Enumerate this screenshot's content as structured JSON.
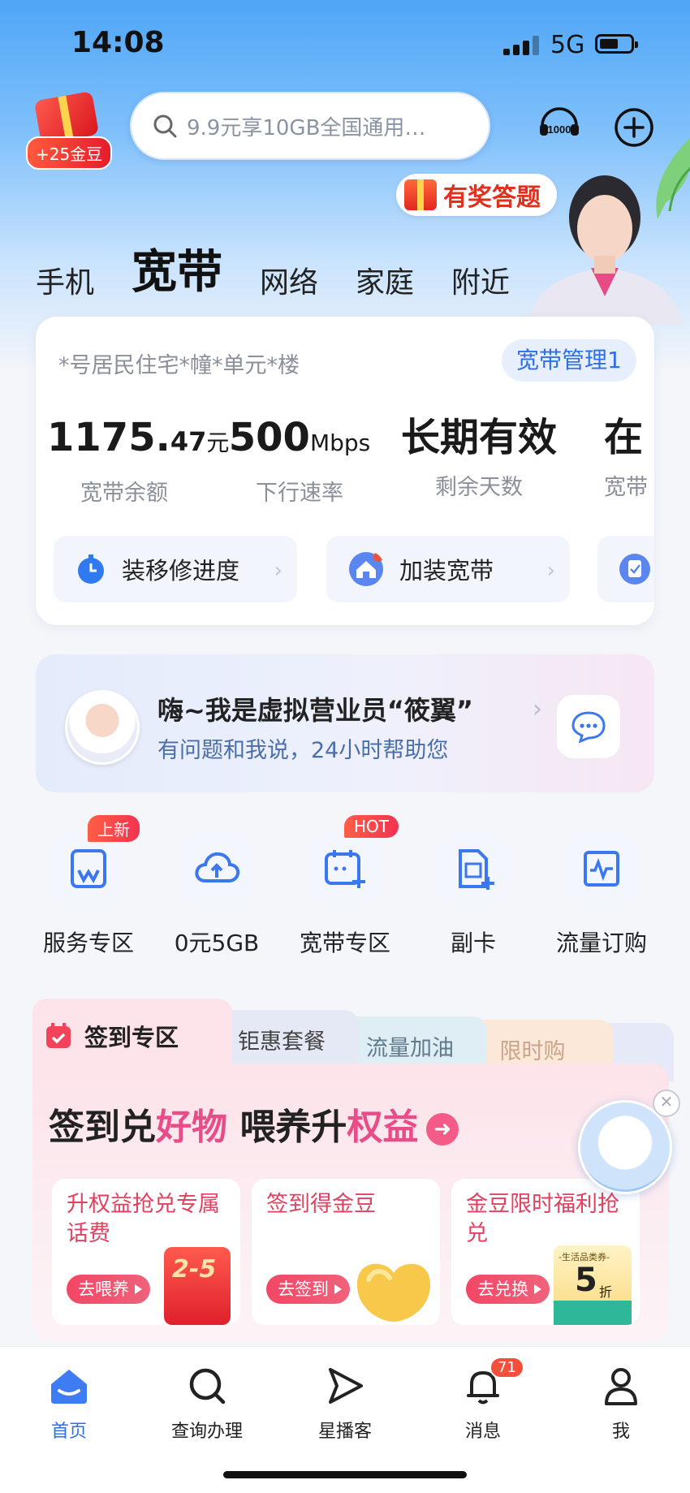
{
  "status_bar": {
    "time": "14:08",
    "network": "5G"
  },
  "header": {
    "coin_badge": "+25金豆",
    "search_placeholder": "9.9元享10GB全国通用…",
    "quiz_tag": "有奖答题"
  },
  "tabs": [
    {
      "label": "手机",
      "active": false
    },
    {
      "label": "宽带",
      "active": true
    },
    {
      "label": "网络",
      "active": false
    },
    {
      "label": "家庭",
      "active": false
    },
    {
      "label": "附近",
      "active": false
    }
  ],
  "broadband": {
    "address": "*号居民住宅*幢*单元*楼",
    "manage_label": "宽带管理1",
    "stats": [
      {
        "int": "1175.",
        "dec": "47",
        "unit": "元",
        "label": "宽带余额"
      },
      {
        "int": "500",
        "dec": "",
        "unit": "Mbps",
        "label": "下行速率"
      },
      {
        "int": "长期有效",
        "dec": "",
        "unit": "",
        "label": "剩余天数"
      },
      {
        "int": "在",
        "dec": "",
        "unit": "",
        "label": "宽带"
      }
    ],
    "services": [
      {
        "label": "装移修进度"
      },
      {
        "label": "加装宽带"
      }
    ]
  },
  "assistant": {
    "title": "嗨~我是虚拟营业员“筱翼”",
    "subtitle": "有问题和我说，24小时帮助您"
  },
  "quick_links": [
    {
      "label": "服务专区",
      "badge": "上新"
    },
    {
      "label": "0元5GB",
      "badge": ""
    },
    {
      "label": "宽带专区",
      "badge": "HOT"
    },
    {
      "label": "副卡",
      "badge": ""
    },
    {
      "label": "流量订购",
      "badge": ""
    }
  ],
  "signin": {
    "tabs": [
      "签到专区",
      "钜惠套餐",
      "流量加油",
      "限时购"
    ],
    "headline_a": "签到兑",
    "headline_b": "好物",
    "headline_c": " 喂养升",
    "headline_d": "权益",
    "tiles": [
      {
        "title": "升权益抢兑专属话费",
        "button": "去喂养",
        "art": "2-5"
      },
      {
        "title": "签到得金豆",
        "button": "去签到",
        "art": ""
      },
      {
        "title": "金豆限时福利抢兑",
        "button": "去兑换",
        "art": "5",
        "art_unit": "折",
        "art_caption": "-生活品类券-"
      }
    ]
  },
  "bottom_nav": [
    {
      "label": "首页",
      "active": true
    },
    {
      "label": "查询办理",
      "active": false
    },
    {
      "label": "星播客",
      "active": false
    },
    {
      "label": "消息",
      "active": false,
      "badge": "71"
    },
    {
      "label": "我",
      "active": false
    }
  ],
  "colors": {
    "accent": "#2e6fe8",
    "pink": "#e94d89",
    "red": "#f2503b"
  }
}
